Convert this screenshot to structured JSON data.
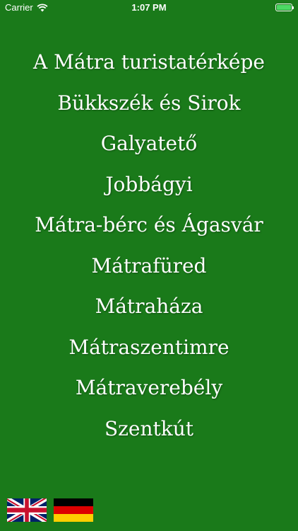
{
  "status_bar": {
    "carrier": "Carrier",
    "time": "1:07 PM",
    "battery_level": 1.0,
    "battery_color": "#4cd964"
  },
  "menu": {
    "items": [
      {
        "label": "A Mátra turistatérképe"
      },
      {
        "label": "Bükkszék és Sirok"
      },
      {
        "label": "Galyatető"
      },
      {
        "label": "Jobbágyi"
      },
      {
        "label": "Mátra-bérc és Ágasvár"
      },
      {
        "label": "Mátrafüred"
      },
      {
        "label": "Mátraháza"
      },
      {
        "label": "Mátraszentimre"
      },
      {
        "label": "Mátraverebély"
      },
      {
        "label": "Szentkút"
      }
    ]
  },
  "language_flags": [
    {
      "icon": "uk-flag-icon"
    },
    {
      "icon": "german-flag-icon"
    }
  ],
  "colors": {
    "background": "#1a7a1a",
    "text": "#ffffff"
  }
}
